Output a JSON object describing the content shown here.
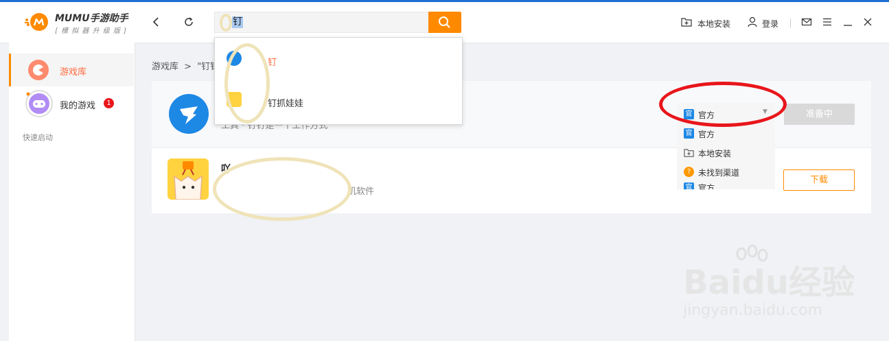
{
  "app": {
    "logo_text": "MUMU手游助手",
    "logo_sub": "[ 模 拟 器 升 级 版 ]"
  },
  "toolbar": {
    "back_icon": "chevron-left-icon",
    "refresh_icon": "refresh-icon",
    "local_install": "本地安装",
    "login": "登录"
  },
  "search": {
    "value": "钉"
  },
  "suggestions": [
    {
      "text": "钉",
      "color": "#ff6a3d"
    },
    {
      "text": "钉抓娃娃",
      "color": "#333333"
    }
  ],
  "sidebar": {
    "items": [
      {
        "label": "游戏库"
      },
      {
        "label": "我的游戏",
        "badge": "1"
      }
    ],
    "quick_start": "快速启动"
  },
  "breadcrumb": {
    "root": "游戏库",
    "sep": ">",
    "current": "\"钉钉"
  },
  "results": [
    {
      "title": "",
      "desc": "工具 · 钉钉是一个工作方式",
      "button": "准备中"
    },
    {
      "title": "吖",
      "desc": "机软件",
      "button": "下载"
    }
  ],
  "channel": {
    "selected": "官方",
    "options": [
      "官方",
      "本地安装",
      "未找到渠道",
      "官方"
    ]
  },
  "watermark": {
    "brand": "Baidu经验",
    "url": "jingyan.baidu.com"
  },
  "colors": {
    "accent": "#ff8a00",
    "badge": "#e8161b",
    "official_blue": "#1e88e5"
  }
}
